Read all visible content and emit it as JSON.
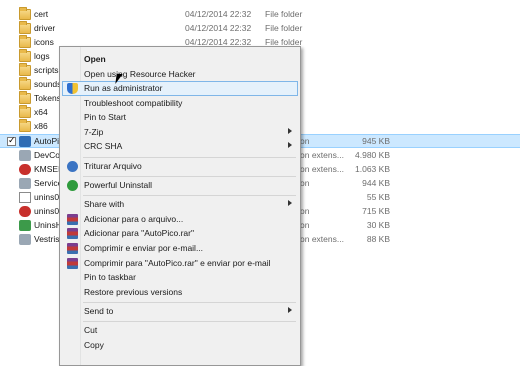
{
  "files": [
    {
      "name": "cert",
      "date": "04/12/2014 22:32",
      "type": "File folder",
      "size": "",
      "icon": "folder-icon"
    },
    {
      "name": "driver",
      "date": "04/12/2014 22:32",
      "type": "File folder",
      "size": "",
      "icon": "folder-icon"
    },
    {
      "name": "icons",
      "date": "04/12/2014 22:32",
      "type": "File folder",
      "size": "",
      "icon": "folder-icon"
    },
    {
      "name": "logs",
      "date": "",
      "type": "",
      "size": "",
      "icon": "folder-icon"
    },
    {
      "name": "scripts",
      "date": "",
      "type": "",
      "size": "",
      "icon": "folder-icon"
    },
    {
      "name": "sounds",
      "date": "",
      "type": "",
      "size": "",
      "icon": "folder-icon"
    },
    {
      "name": "Tokens",
      "date": "",
      "type": "",
      "size": "",
      "icon": "folder-icon"
    },
    {
      "name": "x64",
      "date": "",
      "type": "",
      "size": "",
      "icon": "folder-icon"
    },
    {
      "name": "x86",
      "date": "",
      "type": "",
      "size": "",
      "icon": "folder-icon"
    },
    {
      "name": "AutoPico",
      "date": "",
      "type": "on",
      "size": "945 KB",
      "icon": "app-icon",
      "selected": true
    },
    {
      "name": "DevCon",
      "date": "",
      "type": "on extens...",
      "size": "4.980 KB",
      "icon": "app-icon"
    },
    {
      "name": "KMSELD",
      "date": "",
      "type": "on extens...",
      "size": "1.063 KB",
      "icon": "app-icon"
    },
    {
      "name": "Service_",
      "date": "",
      "type": "on",
      "size": "944 KB",
      "icon": "app-icon"
    },
    {
      "name": "unins00",
      "date": "",
      "type": "",
      "size": "55 KB",
      "icon": "file-icon"
    },
    {
      "name": "unins00",
      "date": "",
      "type": "on",
      "size": "715 KB",
      "icon": "app-icon"
    },
    {
      "name": "UninsH",
      "date": "",
      "type": "on",
      "size": "30 KB",
      "icon": "app-icon"
    },
    {
      "name": "Vestris.",
      "date": "",
      "type": "on extens...",
      "size": "88 KB",
      "icon": "app-icon"
    }
  ],
  "context_menu": {
    "items": [
      {
        "label": "Open",
        "bold": true,
        "icon": "",
        "submenu": false
      },
      {
        "label": "Open using Resource Hacker",
        "icon": "",
        "submenu": false
      },
      {
        "label": "Run as administrator",
        "icon": "shield-icon",
        "submenu": false,
        "highlighted": true
      },
      {
        "label": "Troubleshoot compatibility",
        "icon": "",
        "submenu": false
      },
      {
        "label": "Pin to Start",
        "icon": "",
        "submenu": false
      },
      {
        "label": "7-Zip",
        "icon": "",
        "submenu": true
      },
      {
        "label": "CRC SHA",
        "icon": "",
        "submenu": true
      },
      {
        "label": "Triturar Arquivo",
        "icon": "shred-icon",
        "submenu": false
      },
      {
        "label": "Powerful Uninstall",
        "icon": "uninstall-icon",
        "submenu": false
      },
      {
        "label": "Share with",
        "icon": "",
        "submenu": true
      },
      {
        "label": "Adicionar para o arquivo...",
        "icon": "winrar-icon",
        "submenu": false
      },
      {
        "label": "Adicionar para \"AutoPico.rar\"",
        "icon": "winrar-icon",
        "submenu": false
      },
      {
        "label": "Comprimir e enviar por e-mail...",
        "icon": "winrar-icon",
        "submenu": false
      },
      {
        "label": "Comprimir para \"AutoPico.rar\" e enviar por e-mail",
        "icon": "winrar-icon",
        "submenu": false
      },
      {
        "label": "Pin to taskbar",
        "icon": "",
        "submenu": false
      },
      {
        "label": "Restore previous versions",
        "icon": "",
        "submenu": false
      },
      {
        "label": "Send to",
        "icon": "",
        "submenu": true
      },
      {
        "label": "Cut",
        "icon": "",
        "submenu": false
      },
      {
        "label": "Copy",
        "icon": "",
        "submenu": false
      }
    ]
  }
}
